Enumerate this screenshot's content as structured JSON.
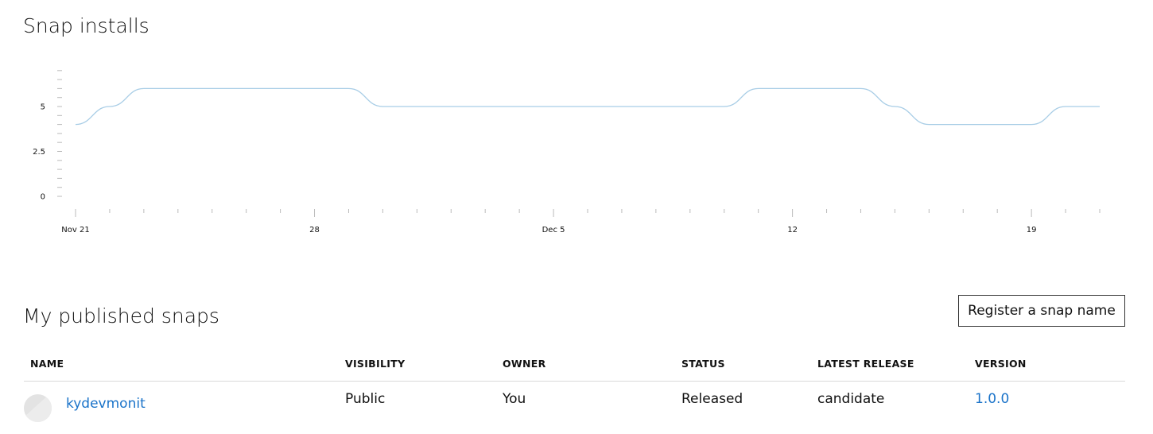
{
  "installs": {
    "title": "Snap installs"
  },
  "chart_data": {
    "type": "line",
    "title": "Snap installs",
    "xlabel": "",
    "ylabel": "",
    "x_tick_labels": [
      "Nov 21",
      "28",
      "Dec 5",
      "12",
      "19"
    ],
    "y_tick_labels": [
      "0",
      "2.5",
      "5"
    ],
    "ylim": [
      0,
      7
    ],
    "grid": false,
    "series": [
      {
        "x": [
          "Nov 21",
          "Nov 22",
          "Nov 23",
          "Nov 24",
          "Nov 25",
          "Nov 26",
          "Nov 27",
          "Nov 28",
          "Nov 29",
          "Nov 30",
          "Dec 1",
          "Dec 2",
          "Dec 3",
          "Dec 4",
          "Dec 5",
          "Dec 6",
          "Dec 7",
          "Dec 8",
          "Dec 9",
          "Dec 10",
          "Dec 11",
          "Dec 12",
          "Dec 13",
          "Dec 14",
          "Dec 15",
          "Dec 16",
          "Dec 17",
          "Dec 18",
          "Dec 19",
          "Dec 20",
          "Dec 21"
        ],
        "values": [
          4,
          5,
          6,
          6,
          6,
          6,
          6,
          6,
          6,
          5,
          5,
          5,
          5,
          5,
          5,
          5,
          5,
          5,
          5,
          5,
          6,
          6,
          6,
          6,
          5,
          4,
          4,
          4,
          4,
          5,
          5
        ],
        "color": "#a8cde6"
      }
    ]
  },
  "published": {
    "title": "My published snaps",
    "register_label": "Register a snap name",
    "columns": [
      "NAME",
      "VISIBILITY",
      "OWNER",
      "STATUS",
      "LATEST RELEASE",
      "VERSION"
    ],
    "rows": [
      {
        "name": "kydevmonit",
        "visibility": "Public",
        "owner": "You",
        "status": "Released",
        "latest_release": "candidate",
        "version": "1.0.0"
      }
    ]
  },
  "colors": {
    "link": "#1a73c9",
    "line": "#a8cde6",
    "text": "#111111",
    "divider": "#d9d9d9"
  },
  "icons": {
    "snap_avatar": "placeholder-snap-icon"
  }
}
